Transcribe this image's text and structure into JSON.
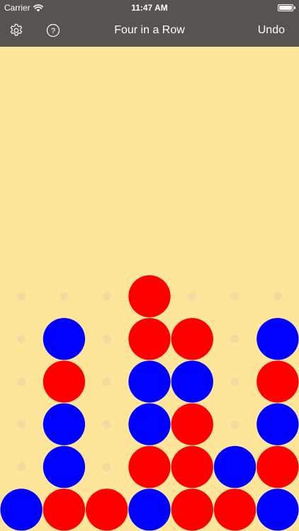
{
  "status_bar": {
    "carrier": "Carrier",
    "time": "11:47 AM"
  },
  "nav": {
    "title": "Four in a Row",
    "undo_label": "Undo",
    "settings_icon": "gear-icon",
    "help_icon": "question-circle-icon"
  },
  "colors": {
    "nav_background": "#575350",
    "board_background": "#fde59a",
    "red_piece": "#ff0000",
    "blue_piece": "#0000ff",
    "empty_slot": "#efdc9e"
  },
  "board": {
    "rows": 6,
    "columns": 7,
    "cells": [
      [
        "empty",
        "empty",
        "empty",
        "red",
        "empty",
        "empty",
        "empty"
      ],
      [
        "empty",
        "blue",
        "empty",
        "red",
        "red",
        "empty",
        "blue"
      ],
      [
        "empty",
        "red",
        "empty",
        "blue",
        "blue",
        "empty",
        "red"
      ],
      [
        "empty",
        "blue",
        "empty",
        "blue",
        "red",
        "empty",
        "blue"
      ],
      [
        "empty",
        "blue",
        "empty",
        "red",
        "red",
        "blue",
        "red"
      ],
      [
        "blue",
        "red",
        "red",
        "blue",
        "red",
        "red",
        "blue"
      ]
    ]
  }
}
